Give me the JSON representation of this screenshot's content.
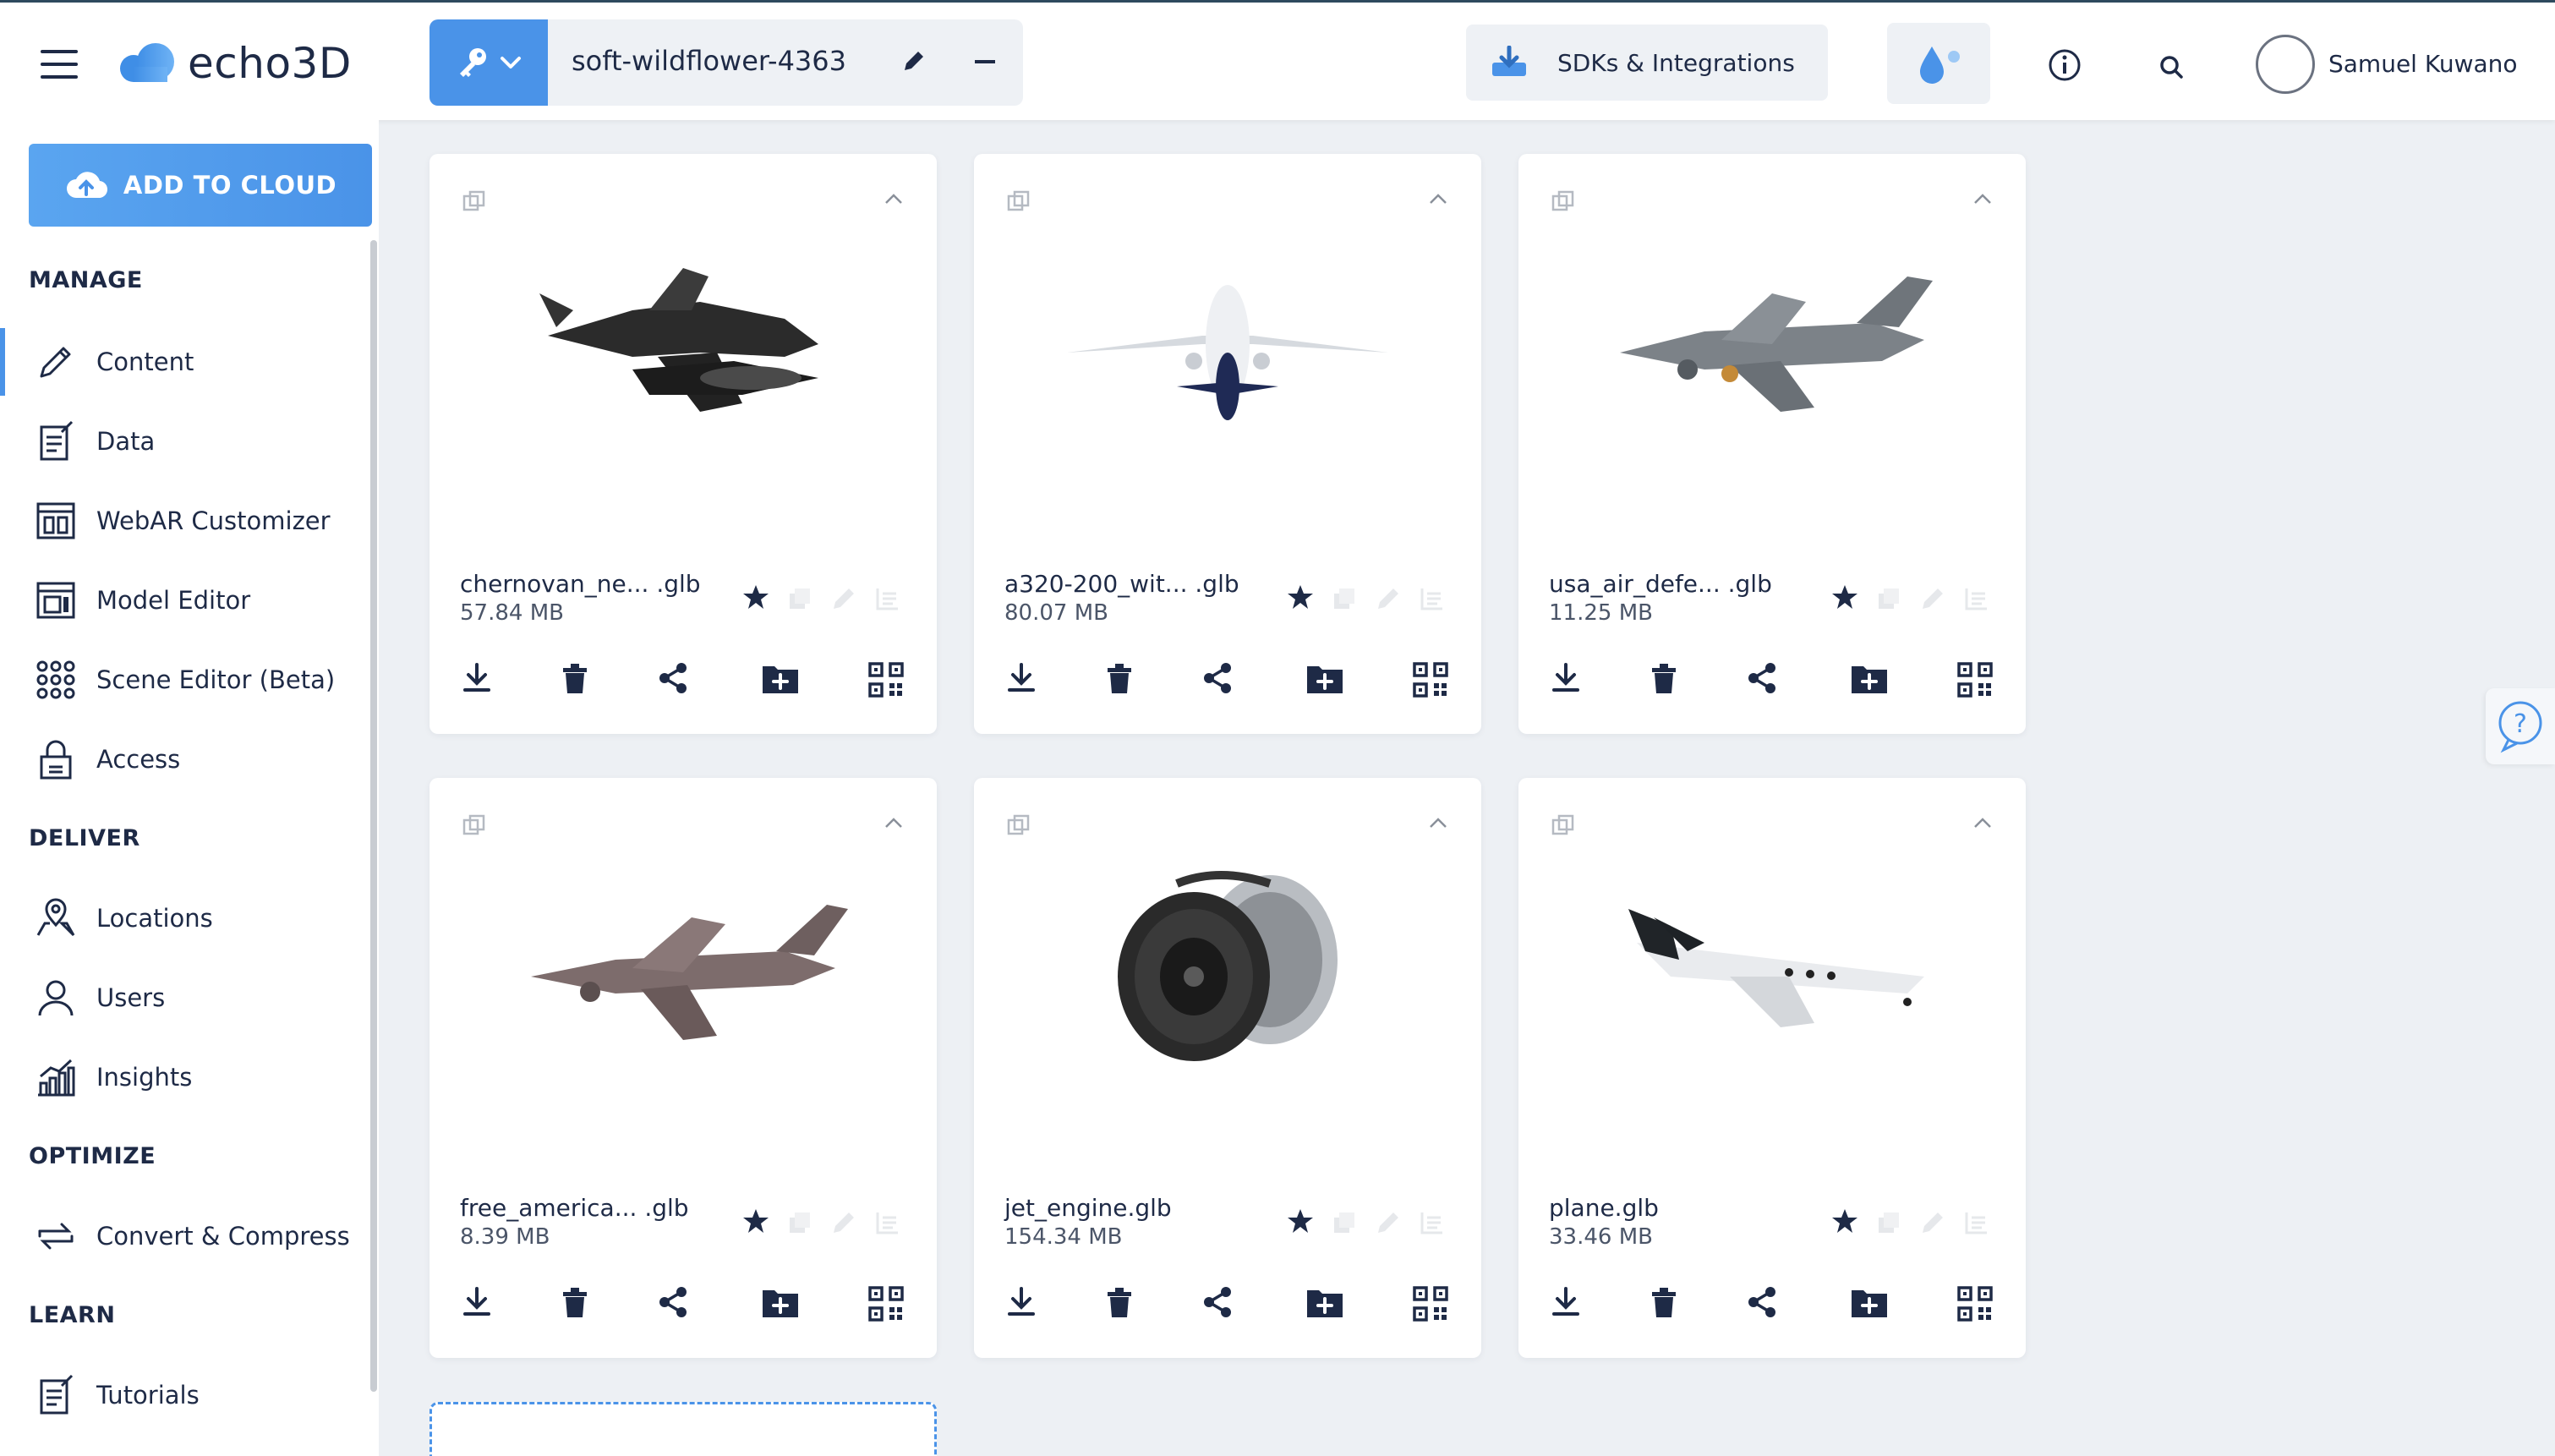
{
  "header": {
    "logo_text": "echo3D",
    "project_name": "soft-wildflower-4363",
    "sdk_label": "SDKs & Integrations",
    "user_name": "Samuel Kuwano"
  },
  "sidebar": {
    "add_to_cloud": "ADD TO CLOUD",
    "sections": {
      "manage": "MANAGE",
      "deliver": "DELIVER",
      "optimize": "OPTIMIZE",
      "learn": "LEARN"
    },
    "items": [
      {
        "label": "Content",
        "icon": "pencil-icon",
        "active": true
      },
      {
        "label": "Data",
        "icon": "data-doc-icon"
      },
      {
        "label": "WebAR Customizer",
        "icon": "webar-icon"
      },
      {
        "label": "Model Editor",
        "icon": "model-editor-icon"
      },
      {
        "label": "Scene Editor (Beta)",
        "icon": "scene-grid-icon"
      },
      {
        "label": "Access",
        "icon": "lock-icon"
      },
      {
        "label": "Locations",
        "icon": "location-pin-icon"
      },
      {
        "label": "Users",
        "icon": "user-icon"
      },
      {
        "label": "Insights",
        "icon": "bar-chart-icon"
      },
      {
        "label": "Convert & Compress",
        "icon": "convert-icon"
      },
      {
        "label": "Tutorials",
        "icon": "tutorial-doc-icon"
      }
    ]
  },
  "cards": [
    {
      "name": "chernovan_ne... .glb",
      "size": "57.84 MB",
      "model": "dark-jet"
    },
    {
      "name": "a320-200_wit... .glb",
      "size": "80.07 MB",
      "model": "airliner"
    },
    {
      "name": "usa_air_defe... .glb",
      "size": "11.25 MB",
      "model": "cargo-grey"
    },
    {
      "name": "free_america... .glb",
      "size": "8.39 MB",
      "model": "cargo-brown"
    },
    {
      "name": "jet_engine.glb",
      "size": "154.34 MB",
      "model": "engine"
    },
    {
      "name": "plane.glb",
      "size": "33.46 MB",
      "model": "bizjet"
    }
  ],
  "colors": {
    "accent": "#4a93e8",
    "navy": "#1e2a46",
    "background": "#edf0f4"
  }
}
